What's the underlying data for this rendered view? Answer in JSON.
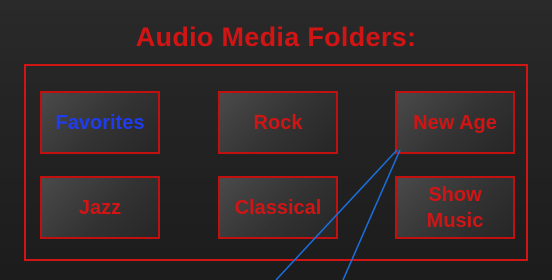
{
  "header": {
    "title": "Audio Media Folders:"
  },
  "folders": [
    {
      "label": "Favorites",
      "selected": true
    },
    {
      "label": "Rock",
      "selected": false
    },
    {
      "label": "New Age",
      "selected": false
    },
    {
      "label": "Jazz",
      "selected": false
    },
    {
      "label": "Classical",
      "selected": false
    },
    {
      "label": "Show Music",
      "selected": false
    }
  ],
  "colors": {
    "accent": "#d11414",
    "selected_text": "#1f3cf0",
    "callout_line": "#1a6fe0",
    "background": "#262626"
  }
}
